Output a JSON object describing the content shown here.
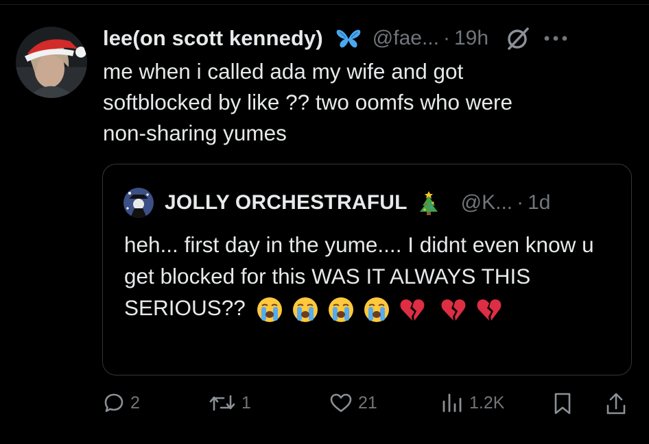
{
  "tweet": {
    "display_name": "lee(on scott kennedy)",
    "handle": "@fae...",
    "separator": "·",
    "time": "19h",
    "text": "me when i called ada my wife and got\nsoftblocked by like ?? two oomfs who were\nnon-sharing yumes"
  },
  "quote": {
    "display_name": "JOLLY ORCHESTRAFUL",
    "handle": "@K...",
    "separator": "·",
    "time": "1d",
    "text": "heh... first day in the yume.... I didnt even know u get blocked for this WAS IT ALWAYS THIS SERIOUS??",
    "emojis": [
      "loudly-crying-face",
      "loudly-crying-face",
      "loudly-crying-face",
      "loudly-crying-face",
      "broken-heart",
      "broken-heart",
      "broken-heart"
    ]
  },
  "actions": {
    "replies": "2",
    "reposts": "1",
    "likes": "21",
    "views": "1.2K"
  },
  "icons": {
    "verified": "butterfly-icon",
    "grok": "grok-icon",
    "more": "more-icon",
    "reply": "reply-icon",
    "repost": "repost-icon",
    "like": "heart-icon",
    "views": "views-icon",
    "bookmark": "bookmark-icon",
    "share": "share-icon"
  },
  "colors": {
    "background": "#000000",
    "text": "#e7e9ea",
    "muted": "#71767b",
    "border": "#333639",
    "verified_blue": "#4aa8f0"
  }
}
